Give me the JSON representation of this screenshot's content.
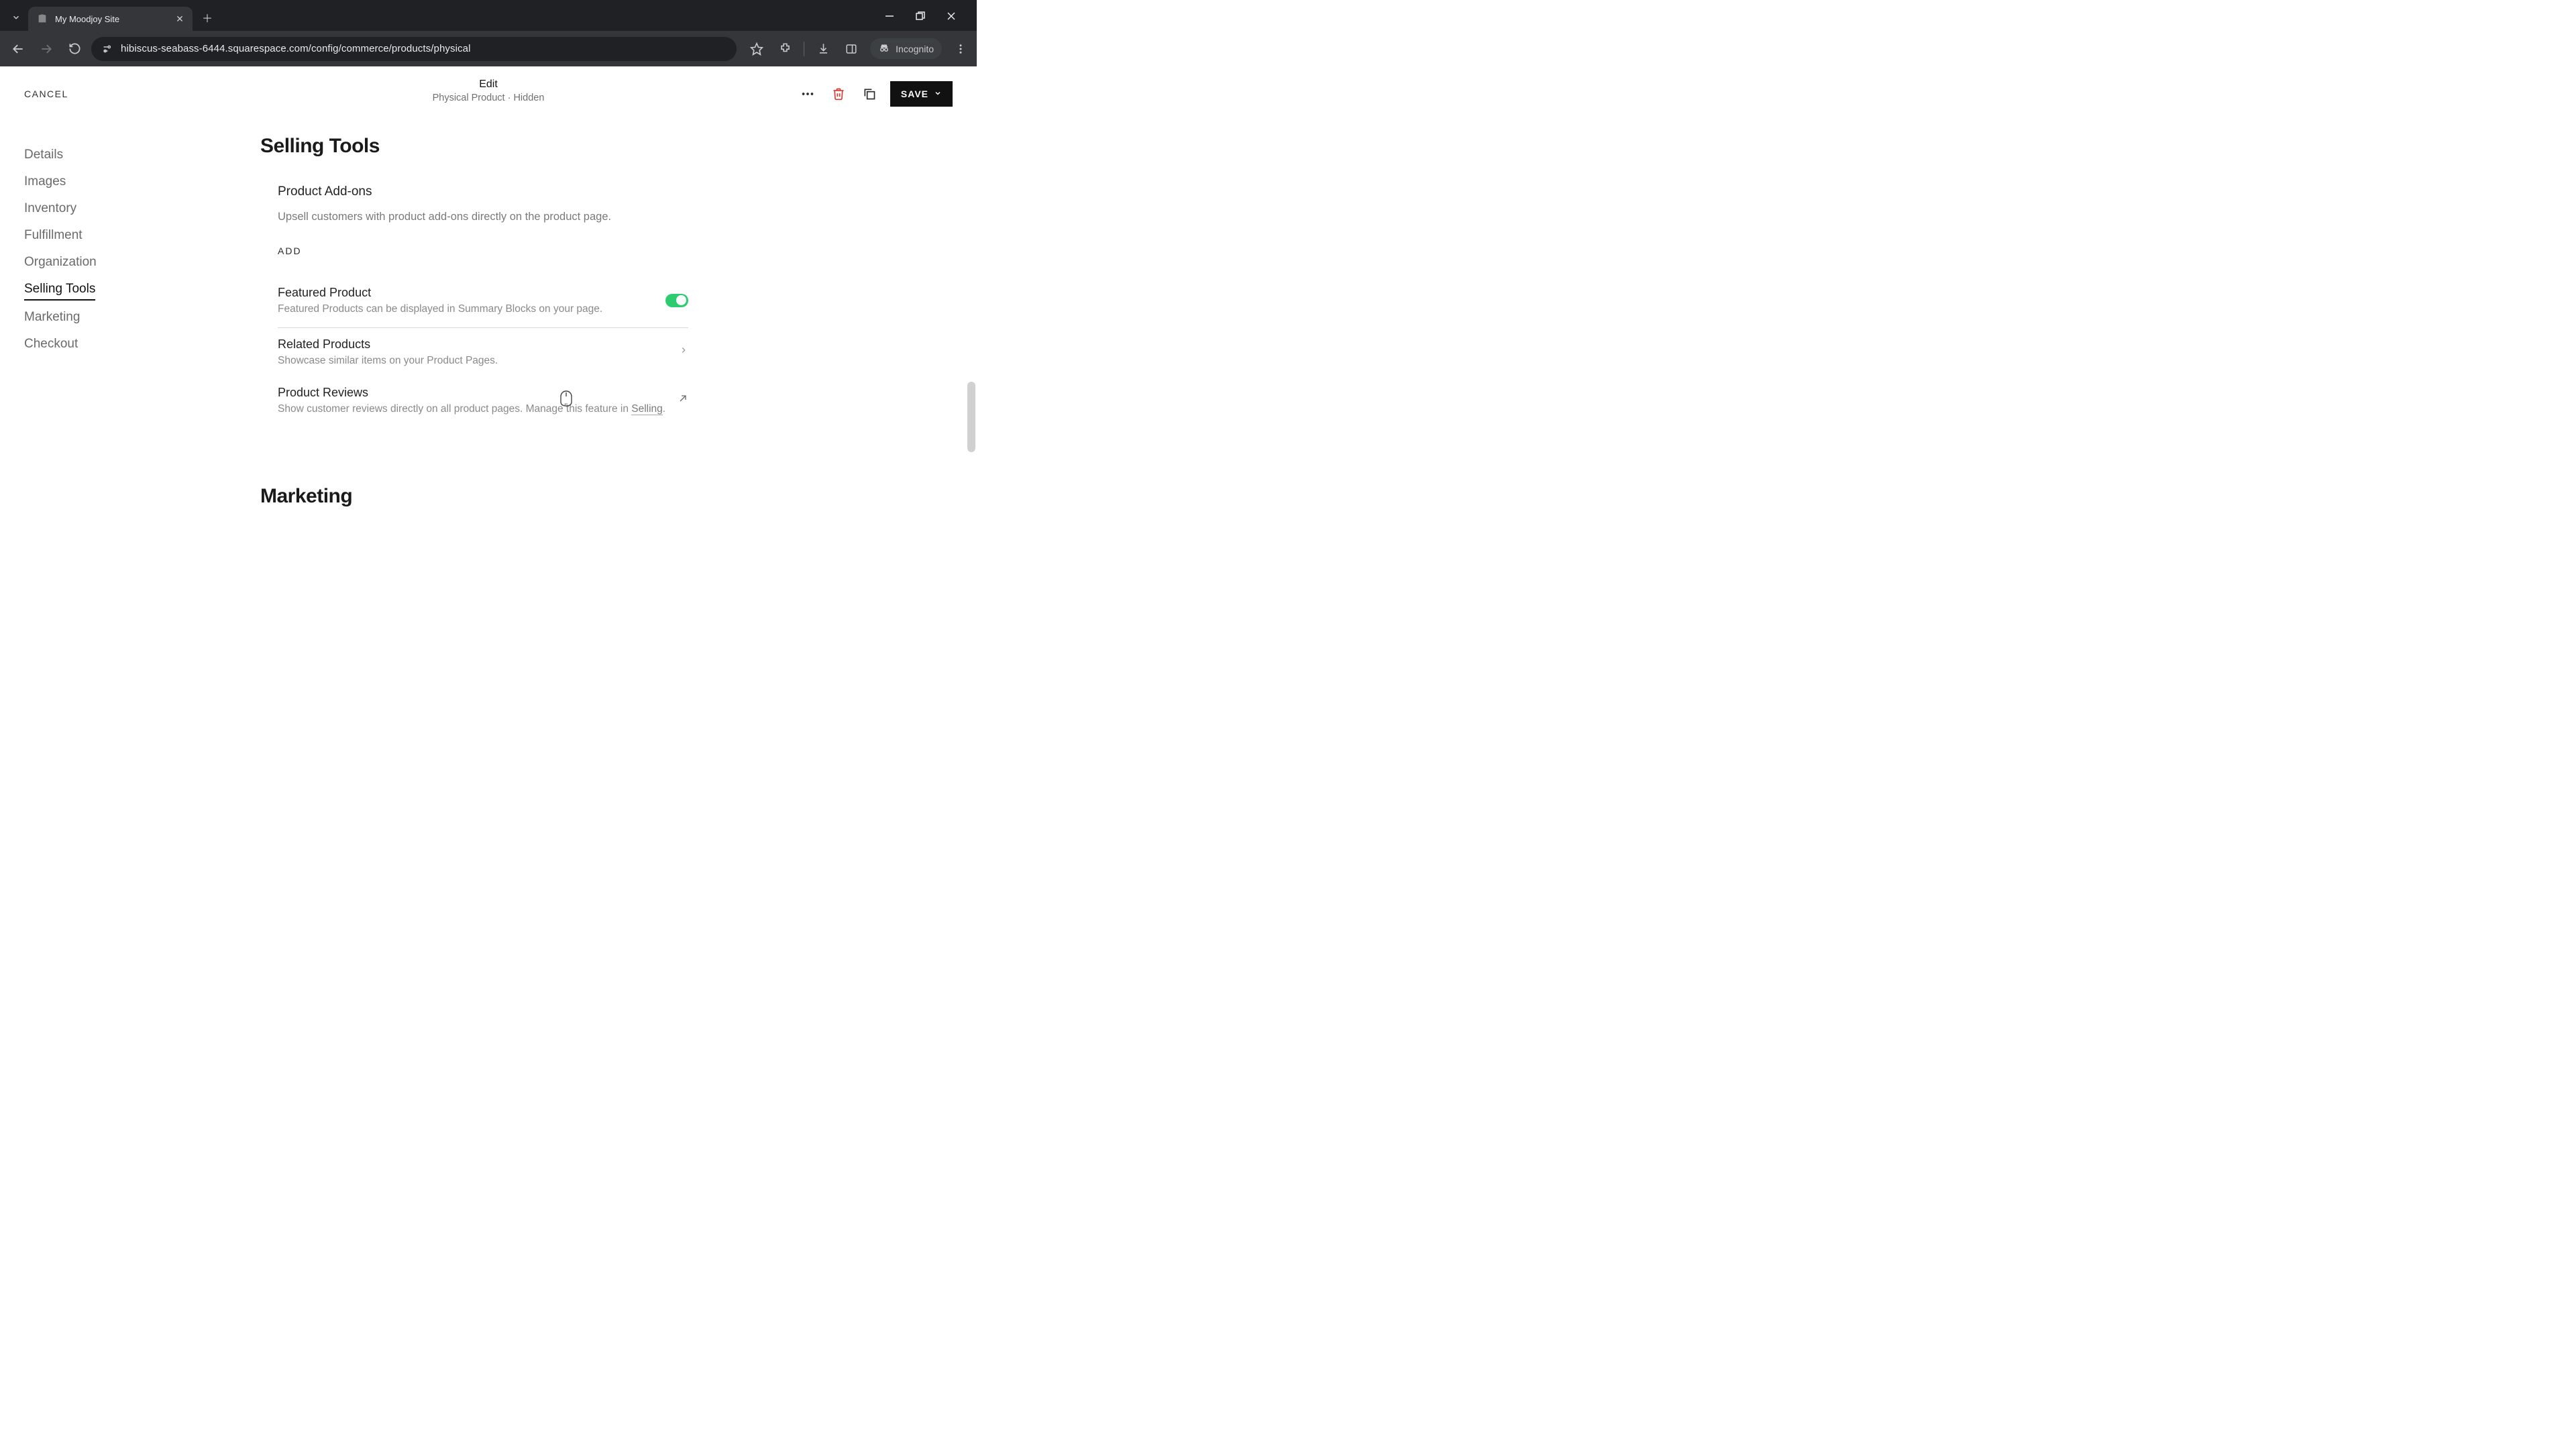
{
  "browser": {
    "tab_title": "My Moodjoy Site",
    "url": "hibiscus-seabass-6444.squarespace.com/config/commerce/products/physical",
    "incognito_label": "Incognito"
  },
  "header": {
    "cancel": "CANCEL",
    "title": "Edit",
    "subtitle": "Physical Product · Hidden",
    "save": "SAVE"
  },
  "sidebar": {
    "items": [
      {
        "label": "Details"
      },
      {
        "label": "Images"
      },
      {
        "label": "Inventory"
      },
      {
        "label": "Fulfillment"
      },
      {
        "label": "Organization"
      },
      {
        "label": "Selling Tools"
      },
      {
        "label": "Marketing"
      },
      {
        "label": "Checkout"
      }
    ]
  },
  "sections": {
    "selling_tools_heading": "Selling Tools",
    "addons": {
      "title": "Product Add-ons",
      "desc": "Upsell customers with product add-ons directly on the product page.",
      "add": "ADD"
    },
    "featured": {
      "title": "Featured Product",
      "desc": "Featured Products can be displayed in Summary Blocks on your page."
    },
    "related": {
      "title": "Related Products",
      "desc": "Showcase similar items on your Product Pages."
    },
    "reviews": {
      "title": "Product Reviews",
      "desc_prefix": "Show customer reviews directly on all product pages. Manage this feature in ",
      "desc_link": "Selling",
      "desc_suffix": "."
    },
    "marketing_heading": "Marketing"
  }
}
